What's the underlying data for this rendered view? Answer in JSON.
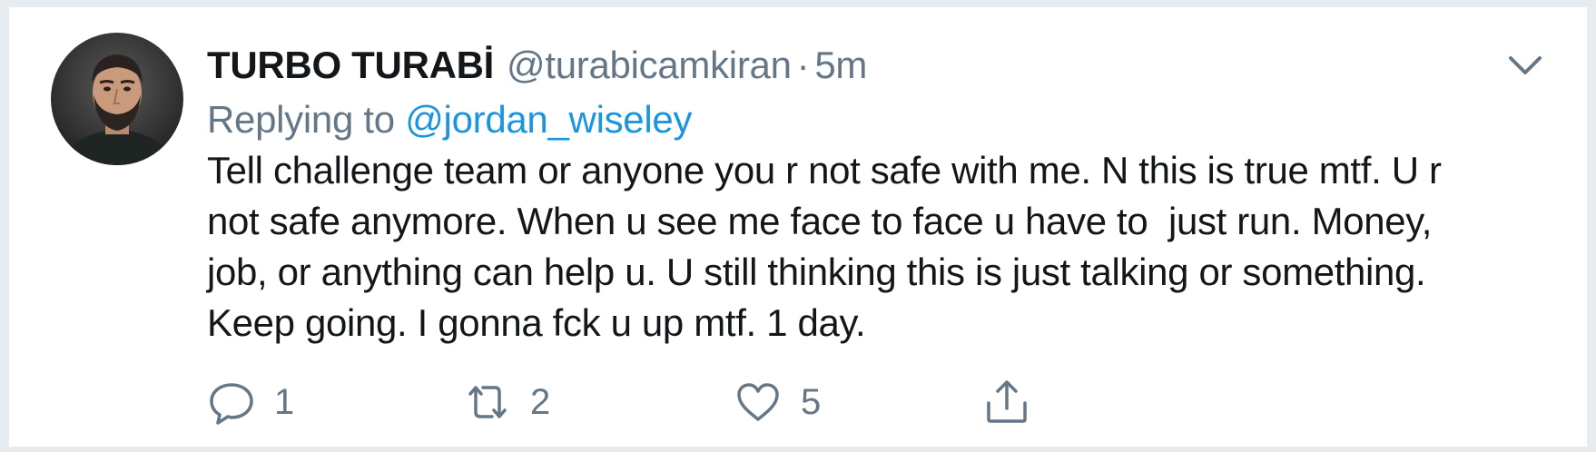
{
  "tweet": {
    "display_name": "TURBO TURABİ",
    "handle": "@turabicamkiran",
    "separator": "·",
    "timestamp": "5m",
    "replying_prefix": "Replying to",
    "replying_to": "@jordan_wiseley",
    "text_lines": [
      "Tell challenge team or anyone you r not safe with me. N this is true mtf. U r",
      "not safe anymore. When u see me face to face u have to  just run. Money,",
      "job, or anything can help u. U still thinking this is just talking or something.",
      "Keep going. I gonna fck u up mtf. 1 day."
    ],
    "actions": {
      "reply_count": "1",
      "retweet_count": "2",
      "like_count": "5"
    }
  },
  "colors": {
    "primary_text": "#14171a",
    "secondary_text": "#657786",
    "link": "#1b95e0",
    "background": "#e6ecf0",
    "card": "#ffffff"
  },
  "icons": {
    "reply": "reply-bubble-icon",
    "retweet": "retweet-icon",
    "like": "heart-icon",
    "share": "share-upload-icon",
    "menu": "chevron-down-icon"
  }
}
